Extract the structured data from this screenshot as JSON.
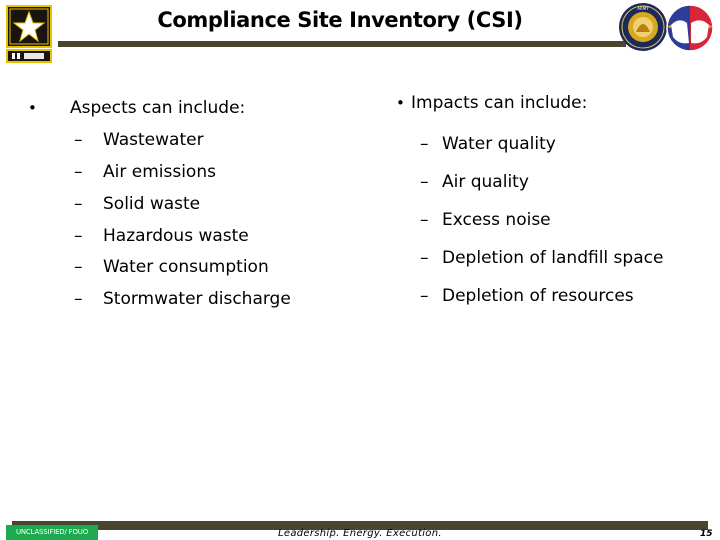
{
  "slide": {
    "title": "Compliance Site Inventory (CSI)",
    "page_number": "15"
  },
  "logos": {
    "left": "us-army-star-logo",
    "right_1": "army-seal",
    "right_2": "eagle-patch"
  },
  "left_column": {
    "bullet_glyph": "•",
    "heading": "Aspects can include:",
    "dash_glyph": "–",
    "items": [
      "Wastewater",
      "Air emissions",
      "Solid waste",
      "Hazardous waste",
      "Water consumption",
      "Stormwater discharge"
    ]
  },
  "right_column": {
    "bullet_glyph": "•",
    "heading": "Impacts can include:",
    "dash_glyph": "–",
    "items": [
      "Water quality",
      "Air quality",
      "Excess noise",
      "Depletion of landfill space",
      "Depletion of resources"
    ]
  },
  "footer": {
    "classification": "UNCLASSIFIED/ FOUO",
    "motto": "Leadership. Energy. Execution."
  },
  "colors": {
    "bar": "#4b4530",
    "badge": "#1daa4f",
    "army_gold": "#f2c400"
  }
}
